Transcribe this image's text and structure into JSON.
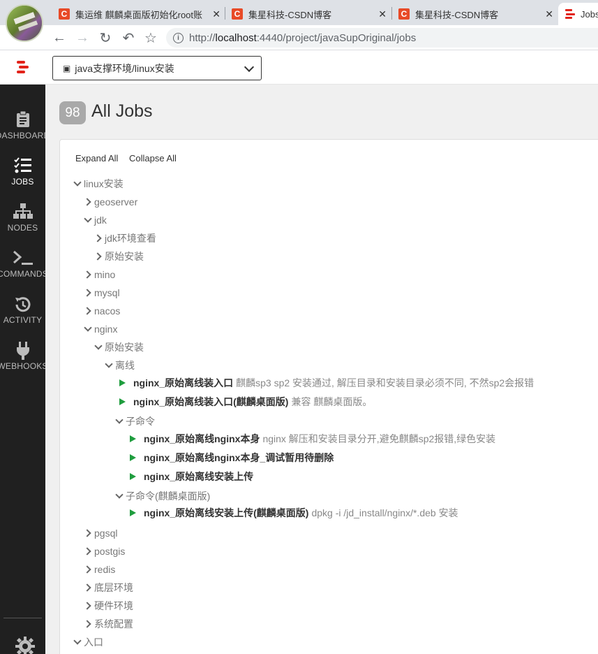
{
  "browser": {
    "tabs": [
      {
        "title": "集运维 麒麟桌面版初始化root账",
        "favicon": "C"
      },
      {
        "title": "集星科技-CSDN博客",
        "favicon": "C"
      },
      {
        "title": "集星科技-CSDN博客",
        "favicon": "C"
      },
      {
        "title": "Jobs"
      }
    ],
    "url_protocol": "http://",
    "url_host": "localhost",
    "url_rest": ":4440/project/javaSupOriginal/jobs"
  },
  "header": {
    "project": "java支撑环境/linux安装"
  },
  "sidebar": {
    "items": [
      {
        "label": "DASHBOARD",
        "icon": "clipboard-icon"
      },
      {
        "label": "JOBS",
        "icon": "tasks-icon"
      },
      {
        "label": "NODES",
        "icon": "sitemap-icon"
      },
      {
        "label": "COMMANDS",
        "icon": "terminal-icon"
      },
      {
        "label": "ACTIVITY",
        "icon": "history-icon"
      },
      {
        "label": "WEBHOOKS",
        "icon": "plug-icon"
      }
    ]
  },
  "main": {
    "job_count": "98",
    "title": "All Jobs",
    "expand_all": "Expand All",
    "collapse_all": "Collapse All",
    "tree": [
      {
        "type": "group",
        "label": "linux安装",
        "open": true,
        "indent": 0
      },
      {
        "type": "group",
        "label": "geoserver",
        "open": false,
        "indent": 1
      },
      {
        "type": "group",
        "label": "jdk",
        "open": true,
        "indent": 1
      },
      {
        "type": "group",
        "label": "jdk环境查看",
        "open": false,
        "indent": 2
      },
      {
        "type": "group",
        "label": "原始安装",
        "open": false,
        "indent": 2
      },
      {
        "type": "group",
        "label": "mino",
        "open": false,
        "indent": 1
      },
      {
        "type": "group",
        "label": "mysql",
        "open": false,
        "indent": 1
      },
      {
        "type": "group",
        "label": "nacos",
        "open": false,
        "indent": 1
      },
      {
        "type": "group",
        "label": "nginx",
        "open": true,
        "indent": 1
      },
      {
        "type": "group",
        "label": "原始安装",
        "open": true,
        "indent": 2
      },
      {
        "type": "group",
        "label": "离线",
        "open": true,
        "indent": 3
      },
      {
        "type": "job",
        "name": "nginx_原始离线装入口",
        "desc": "麒麟sp3 sp2 安装通过, 解压目录和安装目录必须不同, 不然sp2会报错",
        "indent": 4
      },
      {
        "type": "job",
        "name": "nginx_原始离线装入口(麒麟桌面版)",
        "desc": "兼容 麒麟桌面版。",
        "indent": 4
      },
      {
        "type": "group",
        "label": "子命令",
        "open": true,
        "indent": 4
      },
      {
        "type": "job",
        "name": "nginx_原始离线nginx本身",
        "desc": "nginx 解压和安装目录分开,避免麒麟sp2报错,绿色安装",
        "indent": 5
      },
      {
        "type": "job",
        "name": "nginx_原始离线nginx本身_调试暂用待删除",
        "desc": "",
        "indent": 5
      },
      {
        "type": "job",
        "name": "nginx_原始离线安装上传",
        "desc": "",
        "indent": 5
      },
      {
        "type": "group",
        "label": "子命令(麒麟桌面版)",
        "open": true,
        "indent": 4
      },
      {
        "type": "job",
        "name": "nginx_原始离线安装上传(麒麟桌面版)",
        "desc": "dpkg -i /jd_install/nginx/*.deb 安装",
        "indent": 5
      },
      {
        "type": "group",
        "label": "pgsql",
        "open": false,
        "indent": 1
      },
      {
        "type": "group",
        "label": "postgis",
        "open": false,
        "indent": 1
      },
      {
        "type": "group",
        "label": "redis",
        "open": false,
        "indent": 1
      },
      {
        "type": "group",
        "label": "底层环境",
        "open": false,
        "indent": 1
      },
      {
        "type": "group",
        "label": "硬件环境",
        "open": false,
        "indent": 1
      },
      {
        "type": "group",
        "label": "系统配置",
        "open": false,
        "indent": 1
      },
      {
        "type": "group",
        "label": "入口",
        "open": true,
        "indent": 0
      }
    ]
  }
}
